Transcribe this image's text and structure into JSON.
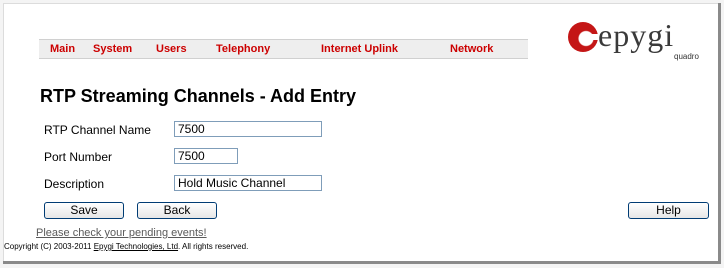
{
  "nav": {
    "items": [
      {
        "label": "Main"
      },
      {
        "label": "System"
      },
      {
        "label": "Users"
      },
      {
        "label": "Telephony"
      },
      {
        "label": "Internet Uplink"
      },
      {
        "label": "Network"
      }
    ]
  },
  "logo": {
    "word": "epygi",
    "sub": "quadro"
  },
  "page": {
    "title": "RTP Streaming Channels - Add Entry"
  },
  "form": {
    "channel_name": {
      "label": "RTP Channel Name",
      "value": "7500"
    },
    "port_number": {
      "label": "Port Number",
      "value": "7500"
    },
    "description": {
      "label": "Description",
      "value": "Hold Music Channel"
    }
  },
  "buttons": {
    "save": "Save",
    "back": "Back",
    "help": "Help"
  },
  "footer": {
    "pending_link": "Please check your pending events!",
    "copyright_prefix": "Copyright (C) 2003-2011 ",
    "company": "Epygi Technologies, Ltd",
    "copyright_suffix": ". All rights reserved."
  },
  "colors": {
    "nav_text": "#cc0000",
    "brand_red": "#c41616"
  }
}
